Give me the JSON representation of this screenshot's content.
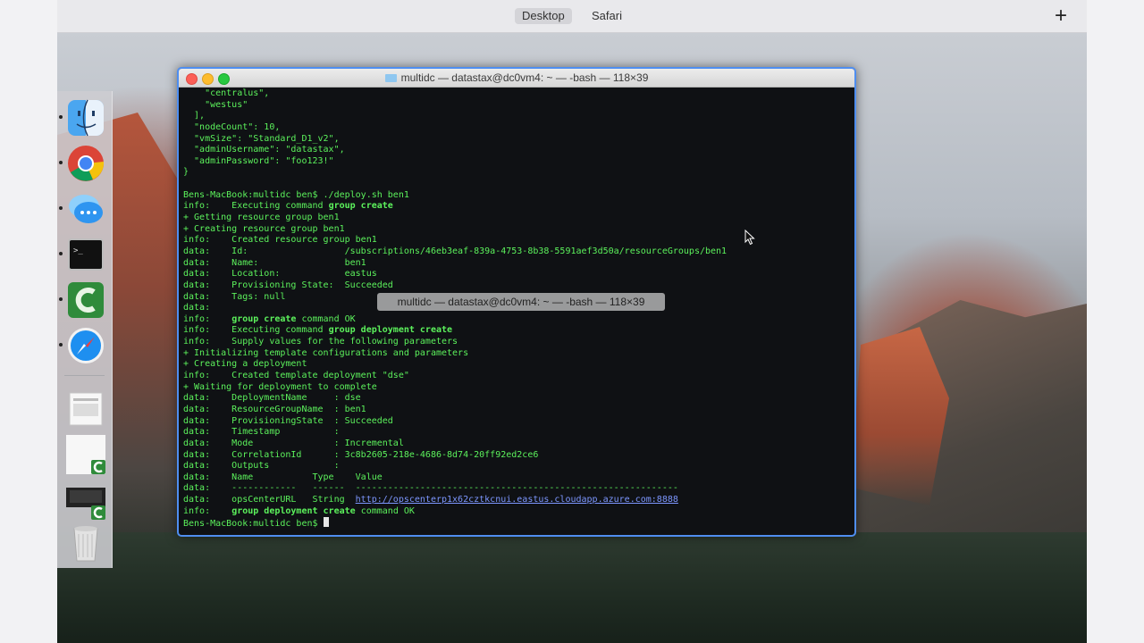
{
  "topbar": {
    "spaces": [
      "Desktop",
      "Safari"
    ],
    "add_space": "+"
  },
  "dock": {
    "items": [
      "finder",
      "chrome",
      "messages",
      "terminal",
      "camtasia",
      "safari",
      "document-stack",
      "camtasia-project",
      "camtasia-recording",
      "trash"
    ]
  },
  "terminal": {
    "title": "multidc — datastax@dc0vm4: ~ — -bash — 118×39",
    "size_overlay": "multidc — datastax@dc0vm4: ~ — -bash — 118×39",
    "lines": [
      [
        {
          "t": "    \"centralus\","
        }
      ],
      [
        {
          "t": "    \"westus\""
        }
      ],
      [
        {
          "t": "  ],"
        }
      ],
      [
        {
          "t": "  \"nodeCount\": 10,"
        }
      ],
      [
        {
          "t": "  \"vmSize\": \"Standard_D1_v2\","
        }
      ],
      [
        {
          "t": "  \"adminUsername\": \"datastax\","
        }
      ],
      [
        {
          "t": "  \"adminPassword\": \"foo123!\""
        }
      ],
      [
        {
          "t": "}"
        }
      ],
      [
        {
          "t": ""
        }
      ],
      [
        {
          "t": "Bens-MacBook:multidc ben$ ./deploy.sh ben1"
        }
      ],
      [
        {
          "t": "info:    Executing command "
        },
        {
          "t": "group create",
          "b": true
        }
      ],
      [
        {
          "t": "+ Getting resource group ben1"
        }
      ],
      [
        {
          "t": "+ Creating resource group ben1"
        }
      ],
      [
        {
          "t": "info:    Created resource group ben1"
        }
      ],
      [
        {
          "t": "data:    Id:                  /subscriptions/46eb3eaf-839a-4753-8b38-5591aef3d50a/resourceGroups/ben1"
        }
      ],
      [
        {
          "t": "data:    Name:                ben1"
        }
      ],
      [
        {
          "t": "data:    Location:            eastus"
        }
      ],
      [
        {
          "t": "data:    Provisioning State:  Succeeded"
        }
      ],
      [
        {
          "t": "data:    Tags: null"
        }
      ],
      [
        {
          "t": "data:"
        }
      ],
      [
        {
          "t": "info:    "
        },
        {
          "t": "group create",
          "b": true
        },
        {
          "t": " command OK"
        }
      ],
      [
        {
          "t": "info:    Executing command "
        },
        {
          "t": "group deployment create",
          "b": true
        }
      ],
      [
        {
          "t": "info:    Supply values for the following parameters"
        }
      ],
      [
        {
          "t": "+ Initializing template configurations and parameters"
        }
      ],
      [
        {
          "t": "+ Creating a deployment"
        }
      ],
      [
        {
          "t": "info:    Created template deployment \"dse\""
        }
      ],
      [
        {
          "t": "+ Waiting for deployment to complete"
        }
      ],
      [
        {
          "t": "data:    DeploymentName     : dse"
        }
      ],
      [
        {
          "t": "data:    ResourceGroupName  : ben1"
        }
      ],
      [
        {
          "t": "data:    ProvisioningState  : Succeeded"
        }
      ],
      [
        {
          "t": "data:    Timestamp          :"
        }
      ],
      [
        {
          "t": "data:    Mode               : Incremental"
        }
      ],
      [
        {
          "t": "data:    CorrelationId      : 3c8b2605-218e-4686-8d74-20ff92ed2ce6"
        }
      ],
      [
        {
          "t": "data:    Outputs            :"
        }
      ],
      [
        {
          "t": "data:    Name           Type    Value"
        }
      ],
      [
        {
          "t": "data:    ------------   ------  ------------------------------------------------------------"
        }
      ],
      [
        {
          "t": "data:    opsCenterURL   String  "
        },
        {
          "t": "http://opscenterp1x62cztkcnui.eastus.cloudapp.azure.com:8888",
          "link": true
        }
      ],
      [
        {
          "t": "info:    "
        },
        {
          "t": "group deployment create",
          "b": true
        },
        {
          "t": " command OK"
        }
      ],
      [
        {
          "t": "Bens-MacBook:multidc ben$ "
        },
        {
          "cursor": true
        }
      ]
    ]
  }
}
